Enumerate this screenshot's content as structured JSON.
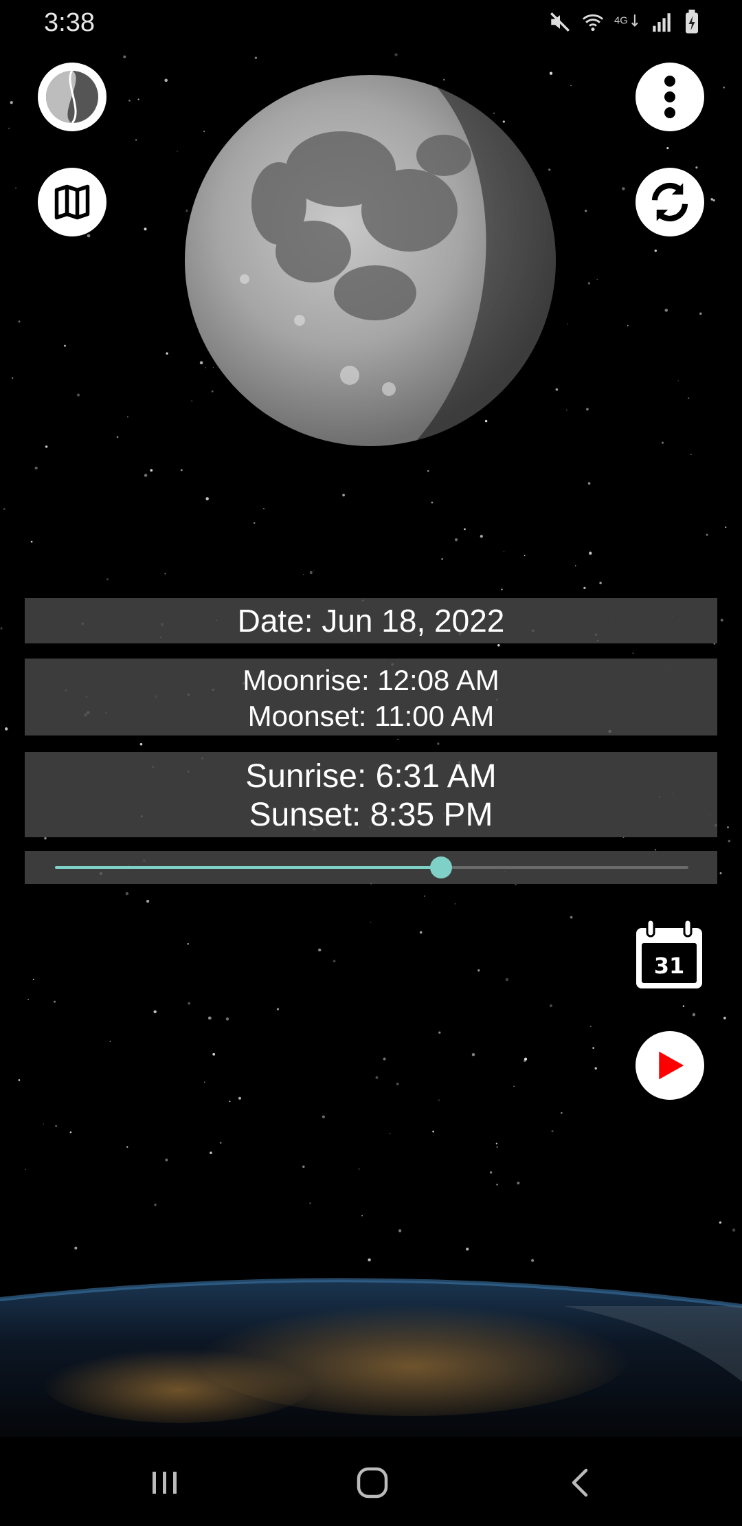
{
  "status_bar": {
    "time": "3:38",
    "icons": [
      "mute-icon",
      "wifi-icon",
      "lte-icon",
      "signal-icon",
      "battery-icon"
    ]
  },
  "toolbar": {
    "left_icons": [
      "moon-phase-icon",
      "map-icon"
    ],
    "right_icons": [
      "more-options-icon",
      "refresh-icon"
    ]
  },
  "info": {
    "date": "Date: Jun 18, 2022",
    "moonrise": "Moonrise: 12:08 AM",
    "moonset": "Moonset: 11:00 AM",
    "sunrise": "Sunrise: 6:31 AM",
    "sunset": "Sunset: 8:35 PM"
  },
  "slider": {
    "value_fraction": 0.61
  },
  "calendar": {
    "day": "31"
  },
  "nav_bar": {
    "icons": [
      "recent-apps-icon",
      "home-icon",
      "back-icon"
    ]
  },
  "colors": {
    "accent": "#7fd0c6",
    "play": "#ff0000",
    "panel": "#464646"
  }
}
